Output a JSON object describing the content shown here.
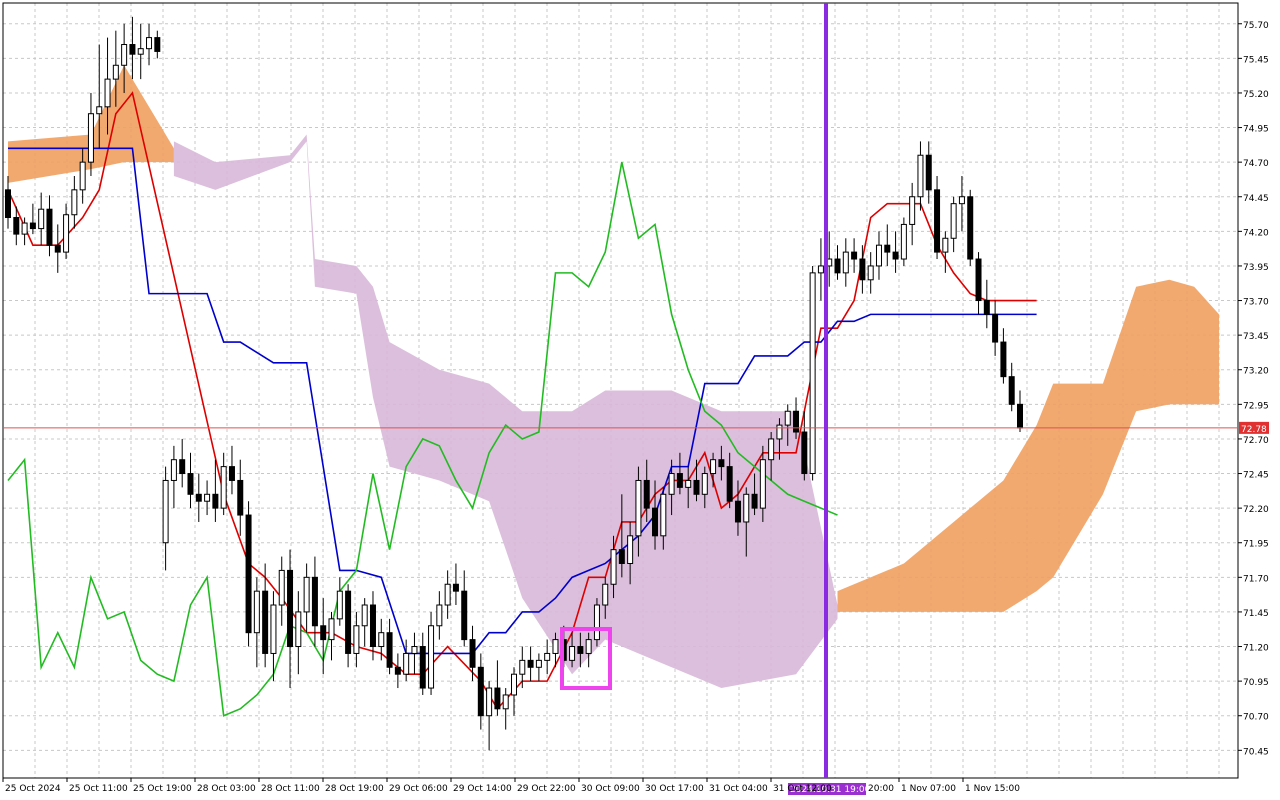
{
  "chart_data": {
    "type": "candlestick",
    "indicators": [
      "Ichimoku Kinko Hyo"
    ],
    "ylim": [
      70.25,
      75.85
    ],
    "yticks": [
      "75.70",
      "75.45",
      "75.20",
      "74.95",
      "74.70",
      "74.45",
      "74.20",
      "73.95",
      "73.70",
      "73.45",
      "73.20",
      "72.95",
      "72.70",
      "72.45",
      "72.20",
      "71.95",
      "71.70",
      "71.45",
      "71.20",
      "70.95",
      "70.70",
      "70.45"
    ],
    "xticks": [
      "25 Oct 2024",
      "25 Oct 11:00",
      "25 Oct 19:00",
      "28 Oct 03:00",
      "28 Oct 11:00",
      "28 Oct 19:00",
      "29 Oct 06:00",
      "29 Oct 14:00",
      "29 Oct 22:00",
      "30 Oct 09:00",
      "30 Oct 17:00",
      "31 Oct 04:00",
      "31 Oct 12:00",
      "1 Nov 07:00",
      "1 Nov 15:00"
    ],
    "current_price": {
      "value": 72.78,
      "label": "72.78"
    },
    "marker": {
      "label": "2024.10.31 19:00"
    },
    "hidden_tick_text": "20:00",
    "candles": [
      [
        74.5,
        74.6,
        74.22,
        74.3
      ],
      [
        74.3,
        74.38,
        74.1,
        74.18
      ],
      [
        74.18,
        74.3,
        74.1,
        74.26
      ],
      [
        74.26,
        74.4,
        74.18,
        74.22
      ],
      [
        74.22,
        74.48,
        74.1,
        74.36
      ],
      [
        74.36,
        74.46,
        74.02,
        74.1
      ],
      [
        74.1,
        74.25,
        73.9,
        74.05
      ],
      [
        74.05,
        74.4,
        74.0,
        74.32
      ],
      [
        74.32,
        74.6,
        74.22,
        74.5
      ],
      [
        74.5,
        74.8,
        74.4,
        74.7
      ],
      [
        74.7,
        75.2,
        74.6,
        75.05
      ],
      [
        75.05,
        75.55,
        74.8,
        75.1
      ],
      [
        75.1,
        75.6,
        74.9,
        75.3
      ],
      [
        75.3,
        75.65,
        75.1,
        75.4
      ],
      [
        75.4,
        75.7,
        75.2,
        75.55
      ],
      [
        75.55,
        75.75,
        75.3,
        75.48
      ],
      [
        75.48,
        75.7,
        75.3,
        75.52
      ],
      [
        75.52,
        75.7,
        75.4,
        75.6
      ],
      [
        75.6,
        75.65,
        75.45,
        75.5
      ],
      [
        71.95,
        72.5,
        71.75,
        72.4
      ],
      [
        72.4,
        72.65,
        72.2,
        72.55
      ],
      [
        72.55,
        72.7,
        72.35,
        72.45
      ],
      [
        72.45,
        72.6,
        72.2,
        72.3
      ],
      [
        72.3,
        72.45,
        72.1,
        72.25
      ],
      [
        72.25,
        72.4,
        72.15,
        72.3
      ],
      [
        72.3,
        72.55,
        72.1,
        72.2
      ],
      [
        72.2,
        72.6,
        72.15,
        72.5
      ],
      [
        72.5,
        72.65,
        72.3,
        72.4
      ],
      [
        72.4,
        72.55,
        72.0,
        72.15
      ],
      [
        72.15,
        72.25,
        71.2,
        71.3
      ],
      [
        71.3,
        71.7,
        71.05,
        71.6
      ],
      [
        71.6,
        71.8,
        71.05,
        71.15
      ],
      [
        71.15,
        71.6,
        70.95,
        71.5
      ],
      [
        71.5,
        71.85,
        71.35,
        71.75
      ],
      [
        71.75,
        71.9,
        70.9,
        71.2
      ],
      [
        71.2,
        71.6,
        71.0,
        71.45
      ],
      [
        71.45,
        71.8,
        71.3,
        71.7
      ],
      [
        71.7,
        71.85,
        71.2,
        71.35
      ],
      [
        71.35,
        71.55,
        71.0,
        71.25
      ],
      [
        71.25,
        71.45,
        71.1,
        71.4
      ],
      [
        71.4,
        71.7,
        71.35,
        71.6
      ],
      [
        71.6,
        71.65,
        71.05,
        71.15
      ],
      [
        71.15,
        71.45,
        71.05,
        71.35
      ],
      [
        71.35,
        71.55,
        71.2,
        71.5
      ],
      [
        71.5,
        71.6,
        71.1,
        71.2
      ],
      [
        71.2,
        71.4,
        71.1,
        71.3
      ],
      [
        71.3,
        71.4,
        71.0,
        71.05
      ],
      [
        71.05,
        71.15,
        70.9,
        71.0
      ],
      [
        71.0,
        71.25,
        70.95,
        71.15
      ],
      [
        71.15,
        71.3,
        71.0,
        71.2
      ],
      [
        71.2,
        71.3,
        70.85,
        70.9
      ],
      [
        70.9,
        71.45,
        70.85,
        71.35
      ],
      [
        71.35,
        71.6,
        71.25,
        71.5
      ],
      [
        71.5,
        71.75,
        71.4,
        71.65
      ],
      [
        71.65,
        71.8,
        71.5,
        71.6
      ],
      [
        71.6,
        71.75,
        71.2,
        71.25
      ],
      [
        71.25,
        71.35,
        70.95,
        71.05
      ],
      [
        71.05,
        71.15,
        70.6,
        70.7
      ],
      [
        70.7,
        70.95,
        70.45,
        70.9
      ],
      [
        70.9,
        71.1,
        70.7,
        70.75
      ],
      [
        70.75,
        70.9,
        70.6,
        70.85
      ],
      [
        70.85,
        71.05,
        70.7,
        71.0
      ],
      [
        71.0,
        71.2,
        70.9,
        71.1
      ],
      [
        71.1,
        71.2,
        70.95,
        71.05
      ],
      [
        71.05,
        71.15,
        70.95,
        71.1
      ],
      [
        71.1,
        71.25,
        71.0,
        71.15
      ],
      [
        71.15,
        71.3,
        71.05,
        71.25
      ],
      [
        71.25,
        71.35,
        71.05,
        71.1
      ],
      [
        71.1,
        71.3,
        71.05,
        71.2
      ],
      [
        71.2,
        71.3,
        71.05,
        71.15
      ],
      [
        71.15,
        71.3,
        71.05,
        71.25
      ],
      [
        71.25,
        71.55,
        71.2,
        71.5
      ],
      [
        71.5,
        71.7,
        71.4,
        71.65
      ],
      [
        71.65,
        72.0,
        71.55,
        71.9
      ],
      [
        71.9,
        72.3,
        71.7,
        71.8
      ],
      [
        71.8,
        72.1,
        71.65,
        72.0
      ],
      [
        72.0,
        72.5,
        71.85,
        72.4
      ],
      [
        72.4,
        72.55,
        72.1,
        72.2
      ],
      [
        72.2,
        72.4,
        71.9,
        72.0
      ],
      [
        72.0,
        72.35,
        71.9,
        72.3
      ],
      [
        72.3,
        72.55,
        72.15,
        72.45
      ],
      [
        72.45,
        72.6,
        72.3,
        72.35
      ],
      [
        72.35,
        72.5,
        72.2,
        72.4
      ],
      [
        72.4,
        72.55,
        72.25,
        72.3
      ],
      [
        72.3,
        72.5,
        72.2,
        72.45
      ],
      [
        72.45,
        72.6,
        72.35,
        72.55
      ],
      [
        72.55,
        72.65,
        72.4,
        72.5
      ],
      [
        72.5,
        72.6,
        72.2,
        72.25
      ],
      [
        72.25,
        72.4,
        72.0,
        72.1
      ],
      [
        72.1,
        72.35,
        71.85,
        72.3
      ],
      [
        72.3,
        72.45,
        72.15,
        72.2
      ],
      [
        72.2,
        72.65,
        72.1,
        72.55
      ],
      [
        72.55,
        72.75,
        72.4,
        72.7
      ],
      [
        72.7,
        72.85,
        72.55,
        72.8
      ],
      [
        72.8,
        72.95,
        72.65,
        72.9
      ],
      [
        72.9,
        73.0,
        72.7,
        72.75
      ],
      [
        72.75,
        72.9,
        72.4,
        72.45
      ],
      [
        72.45,
        73.95,
        72.4,
        73.9
      ],
      [
        73.9,
        74.15,
        73.7,
        73.95
      ],
      [
        73.95,
        74.2,
        73.8,
        74.0
      ],
      [
        74.0,
        74.1,
        73.85,
        73.9
      ],
      [
        73.9,
        74.15,
        73.8,
        74.05
      ],
      [
        74.05,
        74.15,
        73.9,
        74.0
      ],
      [
        74.0,
        74.1,
        73.75,
        73.85
      ],
      [
        73.85,
        74.05,
        73.75,
        73.95
      ],
      [
        73.95,
        74.2,
        73.85,
        74.1
      ],
      [
        74.1,
        74.25,
        73.95,
        74.05
      ],
      [
        74.05,
        74.2,
        73.9,
        74.0
      ],
      [
        74.0,
        74.3,
        73.95,
        74.25
      ],
      [
        74.25,
        74.55,
        74.1,
        74.45
      ],
      [
        74.45,
        74.85,
        74.35,
        74.75
      ],
      [
        74.75,
        74.85,
        74.4,
        74.5
      ],
      [
        74.5,
        74.6,
        74.0,
        74.05
      ],
      [
        74.05,
        74.2,
        73.9,
        74.15
      ],
      [
        74.15,
        74.45,
        74.05,
        74.4
      ],
      [
        74.4,
        74.6,
        74.2,
        74.45
      ],
      [
        74.45,
        74.5,
        73.95,
        74.0
      ],
      [
        74.0,
        74.05,
        73.6,
        73.7
      ],
      [
        73.7,
        73.85,
        73.5,
        73.6
      ],
      [
        73.6,
        73.7,
        73.3,
        73.4
      ],
      [
        73.4,
        73.5,
        73.1,
        73.15
      ],
      [
        73.15,
        73.25,
        72.9,
        72.95
      ],
      [
        72.95,
        73.05,
        72.75,
        72.78
      ]
    ],
    "series": [
      {
        "name": "Tenkan-sen",
        "color": "#dd0000",
        "x": [
          0,
          3,
          6,
          9,
          11,
          13,
          15,
          26,
          29,
          31,
          33,
          36,
          39,
          42,
          45,
          48,
          50,
          53,
          57,
          59,
          62,
          65,
          68,
          70,
          72,
          74,
          76,
          78,
          80,
          82,
          84,
          86,
          88,
          91,
          93,
          95,
          98,
          100,
          102,
          104,
          106,
          108,
          110,
          112,
          114,
          116,
          118,
          120,
          122,
          124
        ],
        "values": [
          74.5,
          74.1,
          74.1,
          74.3,
          74.5,
          75.05,
          75.2,
          72.3,
          71.8,
          71.7,
          71.55,
          71.3,
          71.3,
          71.2,
          71.15,
          71.0,
          71.0,
          71.2,
          70.95,
          70.75,
          70.95,
          70.95,
          71.3,
          71.7,
          71.7,
          72.1,
          72.1,
          72.3,
          72.4,
          72.4,
          72.6,
          72.2,
          72.3,
          72.6,
          72.6,
          72.6,
          73.5,
          73.5,
          73.7,
          74.3,
          74.4,
          74.4,
          74.4,
          74.1,
          73.9,
          73.75,
          73.7,
          73.7,
          73.7,
          73.7
        ]
      },
      {
        "name": "Kijun-sen",
        "color": "#0000cc",
        "x": [
          0,
          15,
          17,
          19,
          24,
          26,
          28,
          32,
          36,
          40,
          42,
          45,
          48,
          50,
          52,
          56,
          58,
          60,
          62,
          64,
          66,
          68,
          70,
          72,
          74,
          76,
          78,
          80,
          82,
          84,
          86,
          88,
          90,
          92,
          94,
          96,
          98,
          100,
          102,
          104,
          106,
          108,
          110,
          112,
          114,
          116,
          118,
          120,
          122,
          124
        ],
        "values": [
          74.8,
          74.8,
          73.75,
          73.75,
          73.75,
          73.4,
          73.4,
          73.25,
          73.25,
          71.75,
          71.75,
          71.7,
          71.15,
          71.15,
          71.15,
          71.15,
          71.3,
          71.3,
          71.45,
          71.45,
          71.55,
          71.7,
          71.75,
          71.8,
          71.9,
          72.0,
          72.15,
          72.5,
          72.5,
          73.1,
          73.1,
          73.1,
          73.3,
          73.3,
          73.3,
          73.4,
          73.4,
          73.55,
          73.55,
          73.6,
          73.6,
          73.6,
          73.6,
          73.6,
          73.6,
          73.6,
          73.6,
          73.6,
          73.6,
          73.6
        ]
      },
      {
        "name": "Chikou Span",
        "color": "#22bb22",
        "x": [
          0,
          2,
          4,
          6,
          8,
          10,
          12,
          14,
          16,
          18,
          20,
          22,
          24,
          26,
          28,
          30,
          32,
          34,
          36,
          38,
          40,
          42,
          44,
          46,
          48,
          50,
          52,
          54,
          56,
          58,
          60,
          62,
          64,
          66,
          68,
          70,
          72,
          74,
          76,
          78,
          80,
          82,
          84,
          86,
          88,
          90,
          92,
          94,
          96,
          98,
          100
        ],
        "values": [
          72.4,
          72.55,
          71.05,
          71.3,
          71.05,
          71.7,
          71.4,
          71.45,
          71.1,
          71.0,
          70.95,
          71.5,
          71.7,
          70.7,
          70.75,
          70.85,
          71.0,
          71.35,
          71.3,
          71.1,
          71.6,
          71.75,
          72.45,
          71.9,
          72.5,
          72.7,
          72.65,
          72.4,
          72.2,
          72.6,
          72.8,
          72.7,
          72.75,
          73.9,
          73.9,
          73.8,
          74.05,
          74.7,
          74.15,
          74.25,
          73.6,
          73.2,
          72.9,
          72.8,
          72.6,
          72.5,
          72.4,
          72.3,
          72.25,
          72.2,
          72.15
        ]
      }
    ],
    "clouds": [
      {
        "name": "Senkou Span A",
        "color": "#f0a060",
        "upper": [
          [
            0,
            74.85
          ],
          [
            10,
            74.9
          ],
          [
            14,
            75.4
          ],
          [
            20,
            74.8
          ]
        ],
        "lower": [
          [
            0,
            74.55
          ],
          [
            10,
            74.65
          ],
          [
            14,
            74.7
          ],
          [
            20,
            74.7
          ]
        ]
      },
      {
        "name": "Senkou Span B",
        "color": "#d8b8d8",
        "upper": [
          [
            20,
            74.85
          ],
          [
            25,
            74.7
          ],
          [
            34,
            74.75
          ],
          [
            36,
            74.9
          ],
          [
            37,
            74.0
          ],
          [
            42,
            73.95
          ],
          [
            44,
            73.8
          ],
          [
            46,
            73.4
          ],
          [
            52,
            73.2
          ],
          [
            58,
            73.1
          ],
          [
            62,
            72.9
          ],
          [
            68,
            72.9
          ],
          [
            72,
            73.05
          ],
          [
            80,
            73.05
          ],
          [
            86,
            72.9
          ],
          [
            95,
            72.9
          ],
          [
            100,
            71.5
          ]
        ],
        "lower": [
          [
            20,
            74.6
          ],
          [
            25,
            74.5
          ],
          [
            34,
            74.7
          ],
          [
            36,
            74.85
          ],
          [
            37,
            73.8
          ],
          [
            42,
            73.75
          ],
          [
            44,
            73.0
          ],
          [
            46,
            72.5
          ],
          [
            52,
            72.4
          ],
          [
            58,
            72.25
          ],
          [
            62,
            71.55
          ],
          [
            68,
            71.0
          ],
          [
            72,
            71.25
          ],
          [
            80,
            71.05
          ],
          [
            86,
            70.9
          ],
          [
            95,
            71.0
          ],
          [
            100,
            71.4
          ]
        ]
      },
      {
        "name": "Future Cloud",
        "color": "#f0a060",
        "upper": [
          [
            100,
            71.6
          ],
          [
            108,
            71.8
          ],
          [
            114,
            72.1
          ],
          [
            120,
            72.4
          ],
          [
            124,
            72.8
          ],
          [
            126,
            73.1
          ],
          [
            132,
            73.1
          ],
          [
            136,
            73.8
          ],
          [
            140,
            73.85
          ],
          [
            143,
            73.8
          ],
          [
            146,
            73.6
          ]
        ],
        "lower": [
          [
            100,
            71.45
          ],
          [
            108,
            71.45
          ],
          [
            114,
            71.45
          ],
          [
            120,
            71.45
          ],
          [
            124,
            71.6
          ],
          [
            126,
            71.7
          ],
          [
            132,
            72.3
          ],
          [
            136,
            72.9
          ],
          [
            140,
            72.95
          ],
          [
            143,
            72.95
          ],
          [
            146,
            72.95
          ]
        ]
      }
    ]
  }
}
